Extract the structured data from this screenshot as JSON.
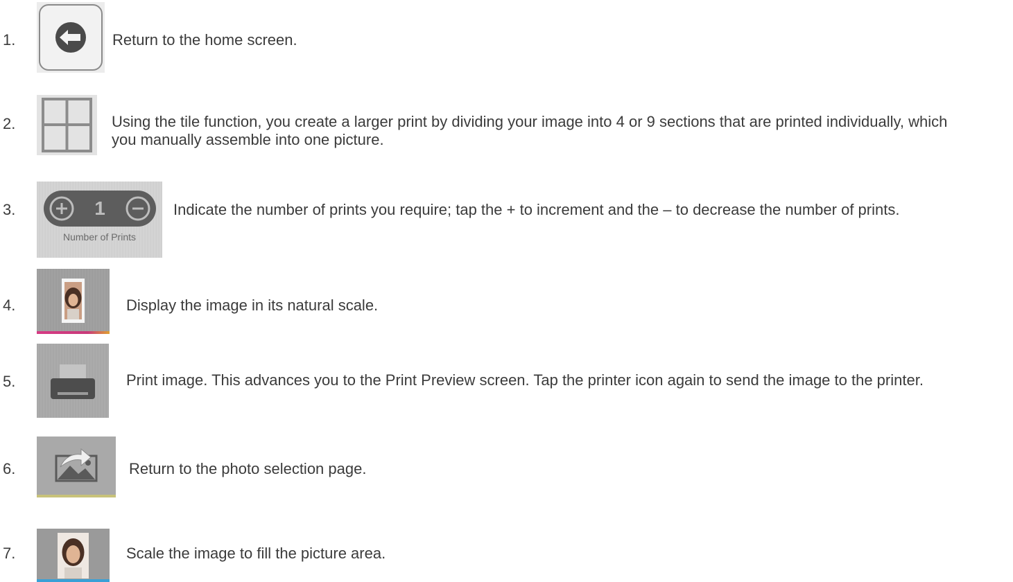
{
  "items": [
    {
      "number": "1.",
      "icon": "back-arrow-icon",
      "text": "Return to the home screen."
    },
    {
      "number": "2.",
      "icon": "tile-grid-icon",
      "text": "Using the tile function, you create a larger print by dividing your image into 4 or 9 sections that are printed individually, which you manually assemble into one picture."
    },
    {
      "number": "3.",
      "icon": "number-of-prints-icon",
      "text": "Indicate the number of prints you require; tap the + to increment and the – to decrease the number of prints.",
      "counter_value": "1",
      "counter_caption": "Number of Prints"
    },
    {
      "number": "4.",
      "icon": "natural-scale-icon",
      "text": "Display the image in its natural scale."
    },
    {
      "number": "5.",
      "icon": "printer-icon",
      "text": "Print image. This advances you to the Print Preview screen. Tap the printer icon again to send the image to the printer."
    },
    {
      "number": "6.",
      "icon": "photo-selection-icon",
      "text": "Return to the photo selection page."
    },
    {
      "number": "7.",
      "icon": "fill-scale-icon",
      "text": "Scale the image to fill the picture area."
    }
  ],
  "colors": {
    "text": "#3b3b3b",
    "icon_dark": "#5d5d5d",
    "natural_bar": "#d63a84",
    "fill_bar": "#3aa0d6"
  }
}
